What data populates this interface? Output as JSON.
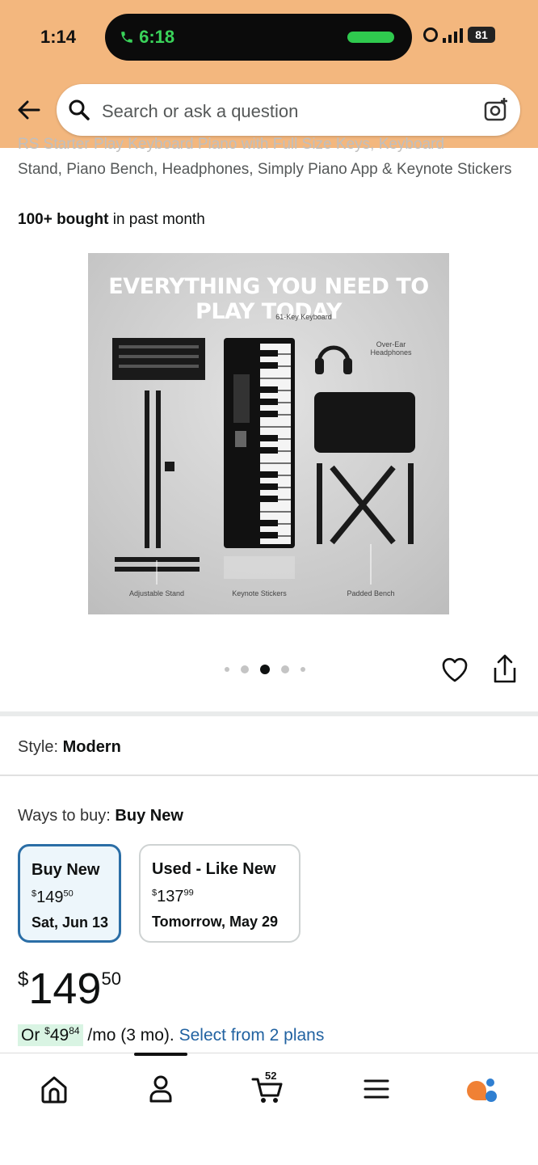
{
  "status_bar": {
    "time": "1:14",
    "call_time": "6:18",
    "battery": "81"
  },
  "search": {
    "placeholder": "Search or ask a question"
  },
  "product": {
    "title_cut_line": "RS Starter Play Keyboard Piano with Full Size Keys, Keyboard",
    "title": "Stand, Piano Bench, Headphones, Simply Piano App & Keynote Stickers",
    "bought_bold": "100+ bought",
    "bought_rest": " in past month",
    "image": {
      "headline": "EVERYTHING YOU NEED TO PLAY TODAY",
      "labels": {
        "keyboard": "61-Key Keyboard",
        "headphones": "Over-Ear Headphones",
        "stand": "Adjustable Stand",
        "stickers": "Keynote Stickers",
        "bench": "Padded Bench"
      }
    },
    "carousel": {
      "count": 5,
      "active_index": 2
    }
  },
  "style": {
    "label": "Style:",
    "value": "Modern"
  },
  "ways_to_buy": {
    "label": "Ways to buy:",
    "value": "Buy New",
    "options": [
      {
        "title": "Buy New",
        "price_cur": "$",
        "price_whole": "149",
        "price_frac": "50",
        "delivery": "Sat, Jun 13",
        "selected": true
      },
      {
        "title": "Used - Like New",
        "price_cur": "$",
        "price_whole": "137",
        "price_frac": "99",
        "delivery": "Tomorrow, May 29",
        "selected": false
      }
    ]
  },
  "price": {
    "currency": "$",
    "whole": "149",
    "fraction": "50"
  },
  "installment": {
    "prefix": "Or ",
    "cur": "$",
    "whole": "49",
    "frac": "84",
    "suffix": " /mo (3 mo). ",
    "link": "Select from 2 plans"
  },
  "bottom_nav": {
    "cart_count": "52",
    "items": [
      "home-icon",
      "account-icon",
      "cart-icon",
      "menu-icon",
      "rufus-assistant-icon"
    ]
  },
  "colors": {
    "header_bg": "#f3b77e",
    "link": "#2162a1",
    "selected_border": "#2b6ea6",
    "installment_highlight": "#d9f4e3"
  }
}
